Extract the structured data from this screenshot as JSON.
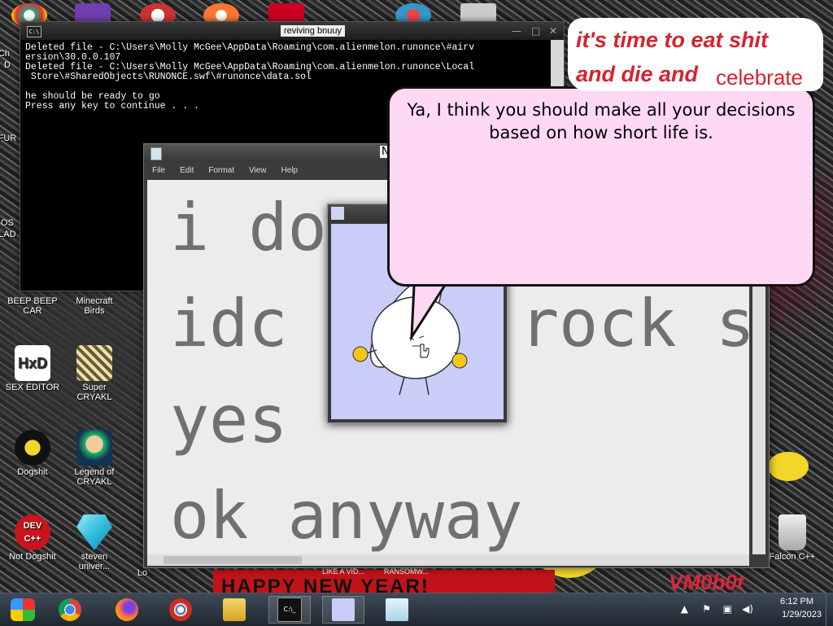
{
  "console": {
    "title": "reviving bnuuy",
    "lines": "Deleted file - C:\\Users\\Molly McGee\\AppData\\Roaming\\com.alienmelon.runonce\\#airv\nersion\\30.0.0.107\nDeleted file - C:\\Users\\Molly McGee\\AppData\\Roaming\\com.alienmelon.runonce\\Local\n Store\\#SharedObjects\\RUNONCE.swf\\#runonce\\data.sol\n\nhe should be ready to go\nPress any key to continue . . ."
  },
  "notepad": {
    "title_partial": "N",
    "menu": [
      "File",
      "Edit",
      "Format",
      "View",
      "Help"
    ],
    "lines": [
      "i do",
      "idc",
      "yes",
      "ok anyway"
    ],
    "hidden_fragment": "rock s"
  },
  "bubble": {
    "text": "Ya, I think you should make all your decisions based on how short life is."
  },
  "caption": {
    "line1": "it's time to eat shit",
    "line2": "and die and",
    "line3": "celebrate"
  },
  "wallpaper": {
    "banner": "HAPPY NEW YEAR!",
    "logo": "VM0b0t",
    "strip_labels": [
      "LIKE A VID...",
      "RANSOMW..."
    ]
  },
  "desktop_icons": [
    {
      "label": "BEEP BEEP CAR"
    },
    {
      "label": "Minecraft Birds"
    },
    {
      "label": "SEX EDITOR"
    },
    {
      "label": "Super CRYAKL"
    },
    {
      "label": "Dogshit"
    },
    {
      "label": "Legend of CRYAKL"
    },
    {
      "label": "Not Dogshit"
    },
    {
      "label": "steven univer..."
    },
    {
      "label": "Falcon C++"
    }
  ],
  "partial_labels": {
    "ch": "Ch",
    "d": "D",
    "fur": "FUR",
    "os": "OS",
    "lad": "LAD",
    "lo": "Lo"
  },
  "taskbar": {
    "time": "6:12 PM",
    "date": "1/29/2023"
  },
  "colors": {
    "bubble_bg": "#ffd8f4",
    "caption_red": "#d6222f",
    "bunny_bg": "#c9cdf8"
  }
}
